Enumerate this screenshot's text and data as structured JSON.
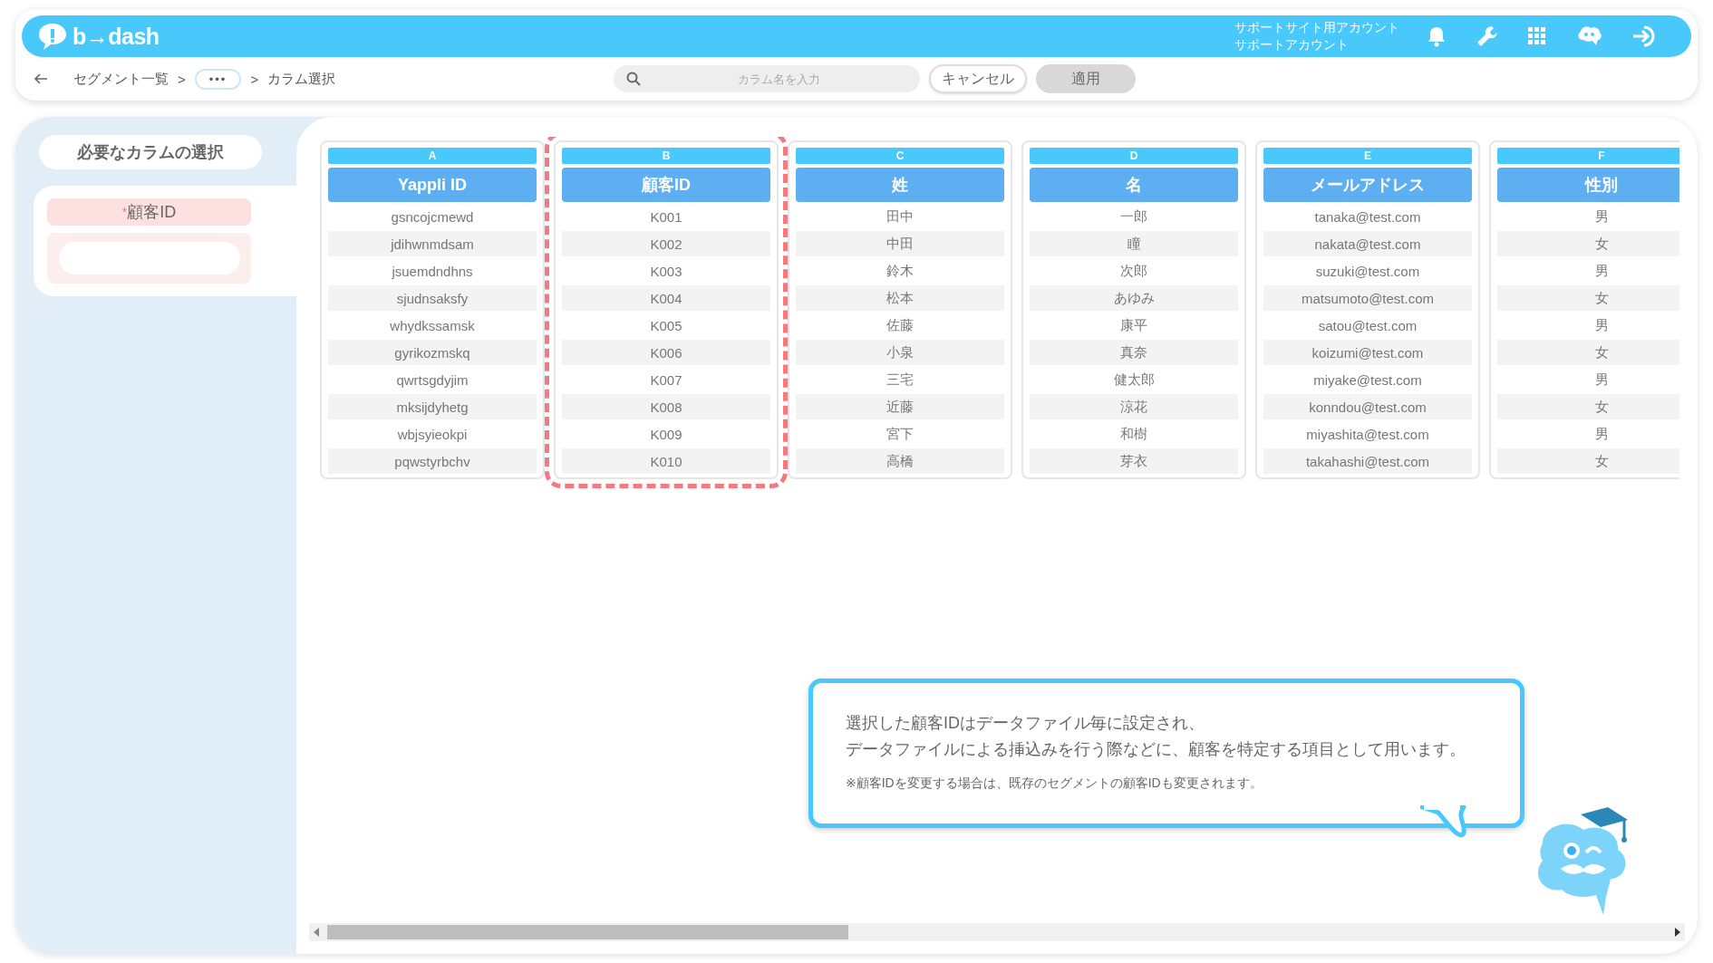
{
  "header": {
    "logo": "b→dash",
    "account_lines": [
      "サポートサイト用アカウント",
      "サポートアカウント"
    ]
  },
  "breadcrumb": {
    "items": [
      {
        "kind": "link",
        "label": "セグメント一覧"
      },
      {
        "kind": "sep",
        "label": ">"
      },
      {
        "kind": "more",
        "label": "•••"
      },
      {
        "kind": "sep",
        "label": ">"
      },
      {
        "kind": "current",
        "label": "カラム選択"
      }
    ]
  },
  "search": {
    "placeholder": "カラム名を入力"
  },
  "buttons": [
    {
      "label": "キャンセル",
      "disabled": false
    },
    {
      "label": "適用",
      "disabled": true
    }
  ],
  "sidebar": {
    "title": "必要なカラムの選択",
    "required_field": {
      "label": "$^{*}$顧客ID"
    }
  },
  "columns": [
    {
      "letter": "A",
      "header": "Yappli ID",
      "selected": false,
      "cells": [
        "gsncojcmewd",
        "jdihwnmdsam",
        "jsuemdndhns",
        "sjudnsaksfy",
        "whydkssamsk",
        "gyrikozmskq",
        "qwrtsgdyjim",
        "mksijdyhetg",
        "wbjsyieokpi",
        "pqwstyrbchv"
      ]
    },
    {
      "letter": "B",
      "header": "顧客ID",
      "selected": true,
      "cells": [
        "K001",
        "K002",
        "K003",
        "K004",
        "K005",
        "K006",
        "K007",
        "K008",
        "K009",
        "K010"
      ]
    },
    {
      "letter": "C",
      "header": "姓",
      "selected": false,
      "cells": [
        "田中",
        "中田",
        "鈴木",
        "松本",
        "佐藤",
        "小泉",
        "三宅",
        "近藤",
        "宮下",
        "高橋"
      ]
    },
    {
      "letter": "D",
      "header": "名",
      "selected": false,
      "cells": [
        "一郎",
        "瞳",
        "次郎",
        "あゆみ",
        "康平",
        "真奈",
        "健太郎",
        "涼花",
        "和樹",
        "芽衣"
      ]
    },
    {
      "letter": "E",
      "header": "メールアドレス",
      "selected": false,
      "cells": [
        "tanaka@test.com",
        "nakata@test.com",
        "suzuki@test.com",
        "matsumoto@test.com",
        "satou@test.com",
        "koizumi@test.com",
        "miyake@test.com",
        "konndou@test.com",
        "miyashita@test.com",
        "takahashi@test.com"
      ]
    },
    {
      "letter": "F",
      "header": "性別",
      "selected": false,
      "cells": [
        "男",
        "女",
        "男",
        "女",
        "男",
        "女",
        "男",
        "女",
        "男",
        "女"
      ]
    }
  ],
  "tooltip": {
    "lines": [
      "選択した顧客IDはデータファイル毎に設定され、",
      "データファイルによる挿込みを行う際などに、顧客を特定する項目として用います。"
    ],
    "note": "※顧客IDを変更する場合は、既存のセグメントの顧客IDも変更されます。"
  }
}
